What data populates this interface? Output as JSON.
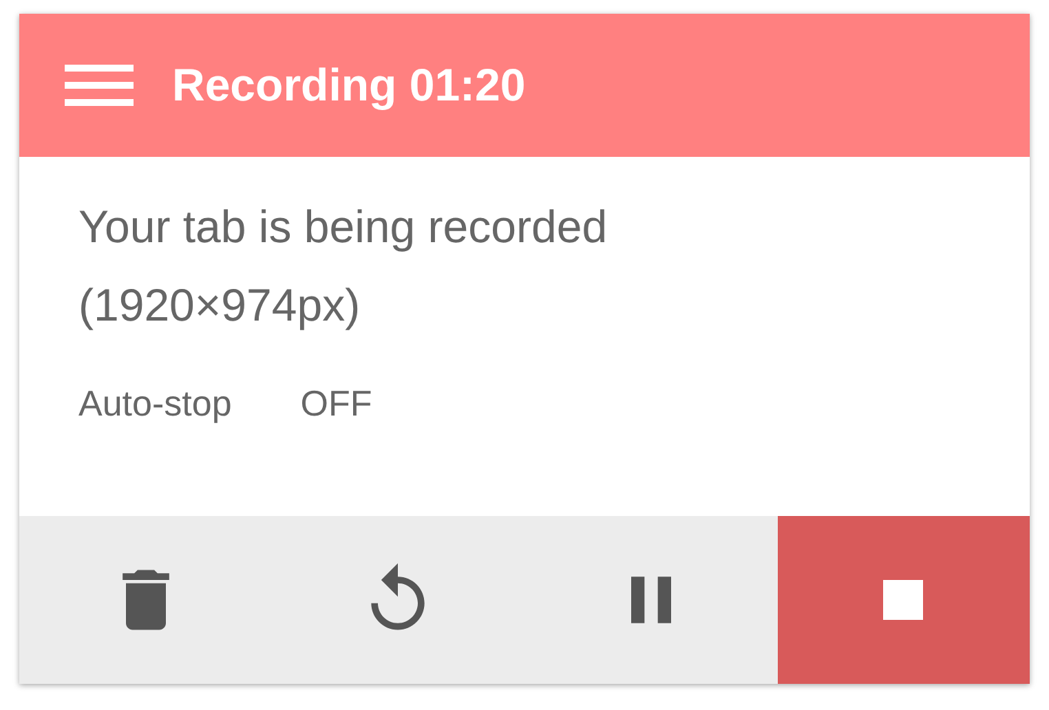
{
  "header": {
    "title": "Recording 01:20"
  },
  "message": "Your tab is being recorded (1920×974px)",
  "auto_stop": {
    "label": "Auto-stop",
    "value": "OFF"
  },
  "buttons": [
    {
      "kind": "delete"
    },
    {
      "kind": "restart"
    },
    {
      "kind": "pause"
    },
    {
      "kind": "stop"
    }
  ]
}
